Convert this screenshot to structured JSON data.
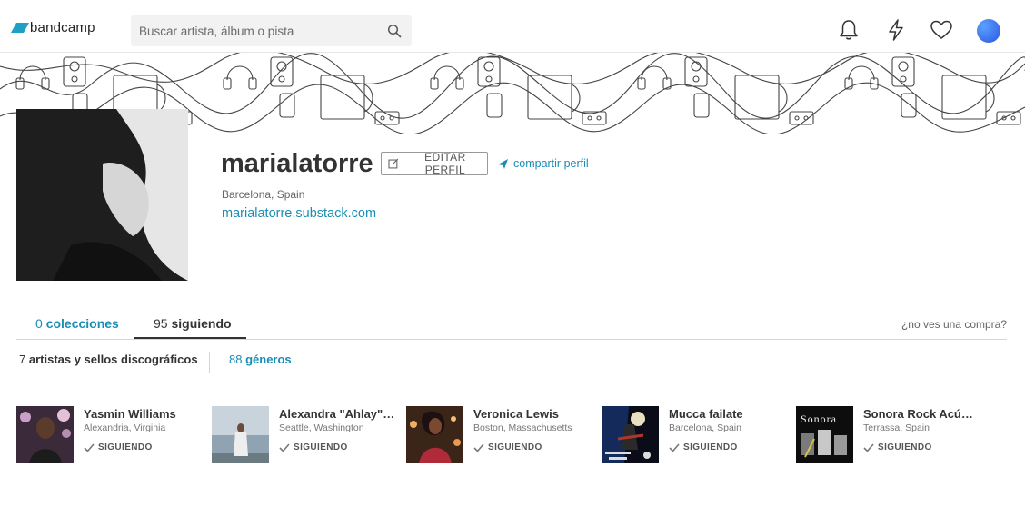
{
  "header": {
    "logo_text": "bandcamp",
    "search_placeholder": "Buscar artista, álbum o pista",
    "icons": [
      "bell-icon",
      "lightning-icon",
      "heart-icon"
    ]
  },
  "profile": {
    "username": "marialatorre",
    "edit_label": "EDITAR PERFIL",
    "share_label": "compartir perfil",
    "location": "Barcelona, Spain",
    "website": "marialatorre.substack.com"
  },
  "tabs": {
    "collections_count": "0",
    "collections_label": "colecciones",
    "following_count": "95",
    "following_label": "siguiendo",
    "missing_purchase": "¿no ves una compra?"
  },
  "filters": {
    "artists_count": "7",
    "artists_label": "artistas y sellos discográficos",
    "genres_count": "88",
    "genres_label": "géneros"
  },
  "following": [
    {
      "name": "Yasmin Williams",
      "location": "Alexandria, Virginia",
      "status": "SIGUIENDO"
    },
    {
      "name": "Alexandra \"Ahlay\"…",
      "location": "Seattle, Washington",
      "status": "SIGUIENDO"
    },
    {
      "name": "Veronica Lewis",
      "location": "Boston, Massachusetts",
      "status": "SIGUIENDO"
    },
    {
      "name": "Mucca failate",
      "location": "Barcelona, Spain",
      "status": "SIGUIENDO"
    },
    {
      "name": "Sonora Rock Acú…",
      "location": "Terrassa, Spain",
      "status": "SIGUIENDO"
    }
  ],
  "thumb_art": {
    "sonora_text": "Sonora"
  },
  "colors": {
    "accent": "#1b8db5",
    "logo": "#1da0c3",
    "avatar": "#3b6ff0"
  }
}
